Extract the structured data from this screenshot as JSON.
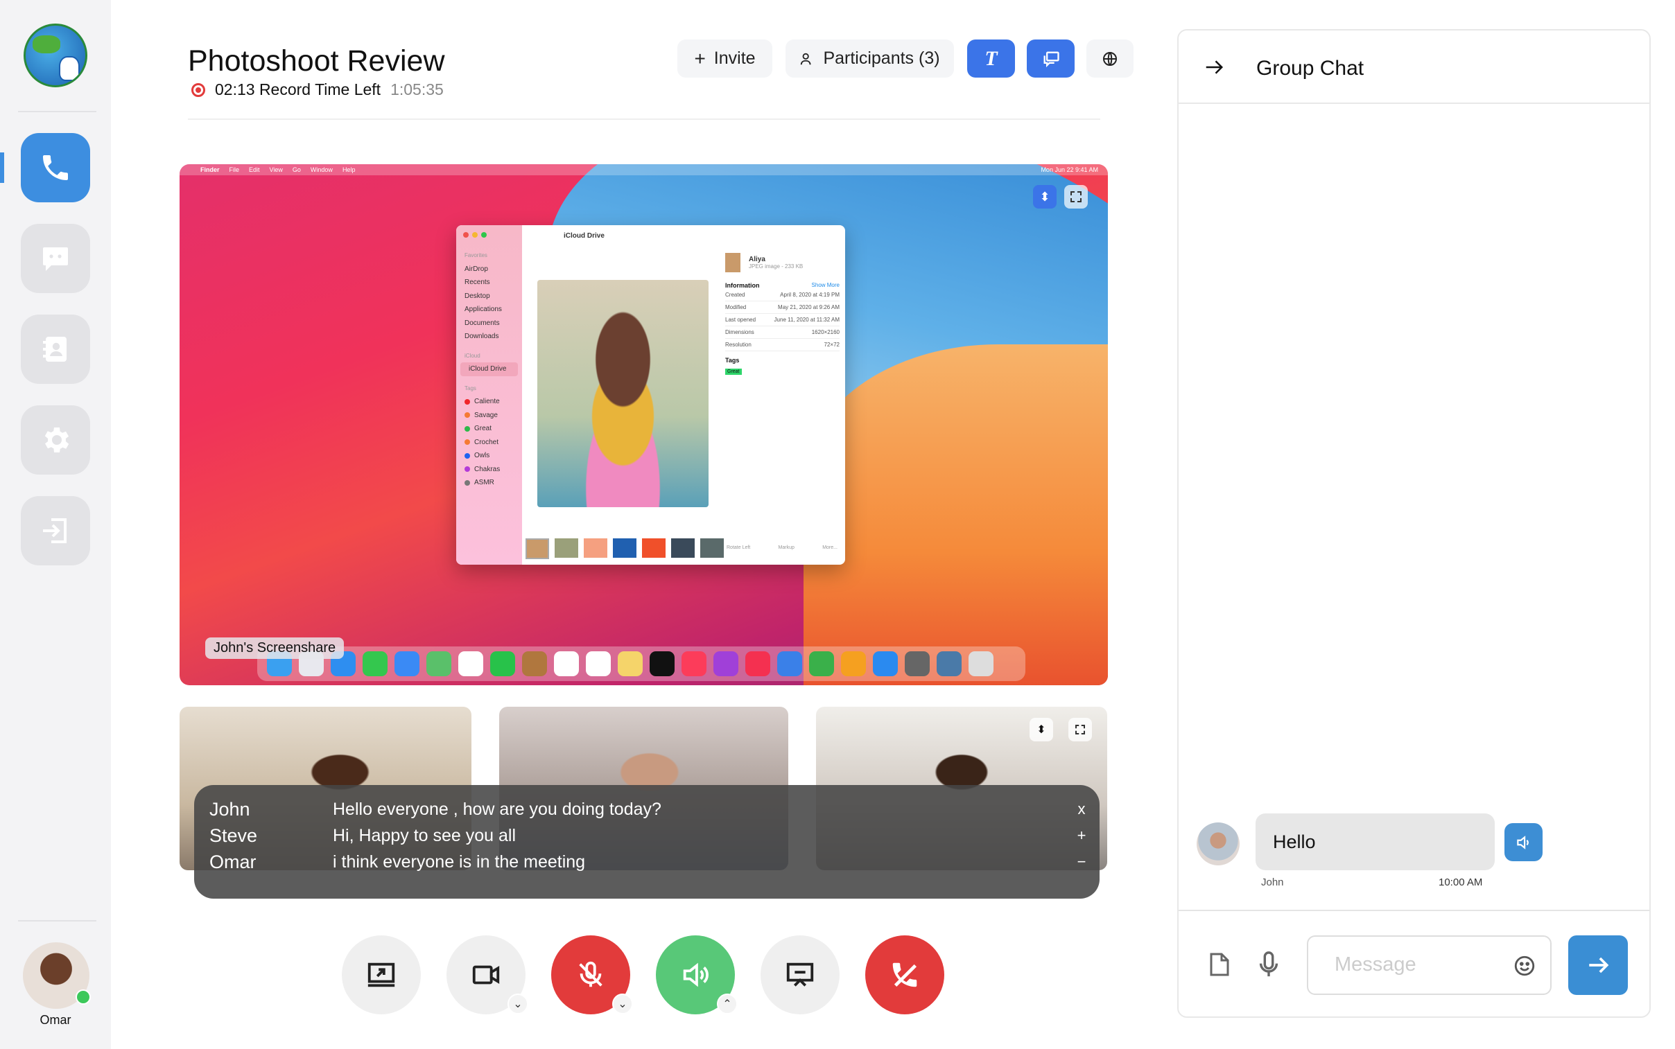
{
  "sidebar": {
    "items": [
      {
        "name": "calls",
        "icon": "phone-icon",
        "active": true
      },
      {
        "name": "messages",
        "icon": "chat-icon"
      },
      {
        "name": "contacts",
        "icon": "contacts-icon"
      },
      {
        "name": "settings",
        "icon": "gear-icon"
      },
      {
        "name": "logout",
        "icon": "logout-icon"
      }
    ],
    "user": {
      "name": "Omar",
      "status": "online",
      "status_color": "#3cc85a"
    }
  },
  "header": {
    "title": "Photoshoot Review",
    "record_time": "02:13 Record Time Left",
    "elapsed": "1:05:35",
    "invite_label": "Invite",
    "participants_label": "Participants (3)"
  },
  "screenshare": {
    "label": "John's Screenshare",
    "menubar": {
      "app": "Finder",
      "menus": [
        "File",
        "Edit",
        "View",
        "Go",
        "Window",
        "Help"
      ],
      "clock": "Mon Jun 22  9:41 AM"
    },
    "finder": {
      "title": "iCloud Drive",
      "favorites_label": "Favorites",
      "favorites": [
        "AirDrop",
        "Recents",
        "Desktop",
        "Applications",
        "Documents",
        "Downloads"
      ],
      "icloud_label": "iCloud",
      "icloud_item": "iCloud Drive",
      "tags_label": "Tags",
      "tags": [
        {
          "name": "Caliente",
          "color": "#f0262b"
        },
        {
          "name": "Savage",
          "color": "#f57a34"
        },
        {
          "name": "Great",
          "color": "#2eb84a"
        },
        {
          "name": "Crochet",
          "color": "#f57a34"
        },
        {
          "name": "Owls",
          "color": "#1f63f0"
        },
        {
          "name": "Chakras",
          "color": "#b33ad8"
        },
        {
          "name": "ASMR",
          "color": "#777777"
        }
      ],
      "file_name": "Aliya",
      "file_meta": "JPEG image - 233 KB",
      "info_label": "Information",
      "show_more": "Show More",
      "info": [
        {
          "k": "Created",
          "v": "April 8, 2020 at 4:19 PM"
        },
        {
          "k": "Modified",
          "v": "May 21, 2020 at 9:26 AM"
        },
        {
          "k": "Last opened",
          "v": "June 11, 2020 at 11:32 AM"
        },
        {
          "k": "Dimensions",
          "v": "1620×2160"
        },
        {
          "k": "Resolution",
          "v": "72×72"
        }
      ],
      "tags_heading": "Tags",
      "tag_badge": "Great",
      "actions": [
        "Rotate Left",
        "Markup",
        "More..."
      ]
    }
  },
  "captions": [
    {
      "speaker": "John",
      "text": "Hello everyone , how are you doing today?"
    },
    {
      "speaker": "Steve",
      "text": "Hi, Happy to see you all"
    },
    {
      "speaker": "Omar",
      "text": "i think everyone is in the meeting"
    }
  ],
  "caption_controls": {
    "close": "x",
    "increase": "+",
    "decrease": "−"
  },
  "chat": {
    "title": "Group Chat",
    "messages": [
      {
        "sender": "John",
        "text": "Hello",
        "time": "10:00 AM"
      }
    ],
    "input_placeholder": "Message"
  },
  "colors": {
    "accent": "#3d8ee0",
    "primary_button": "#3b74e8",
    "end_call": "#e23b3b",
    "speaker_on": "#58c878"
  }
}
